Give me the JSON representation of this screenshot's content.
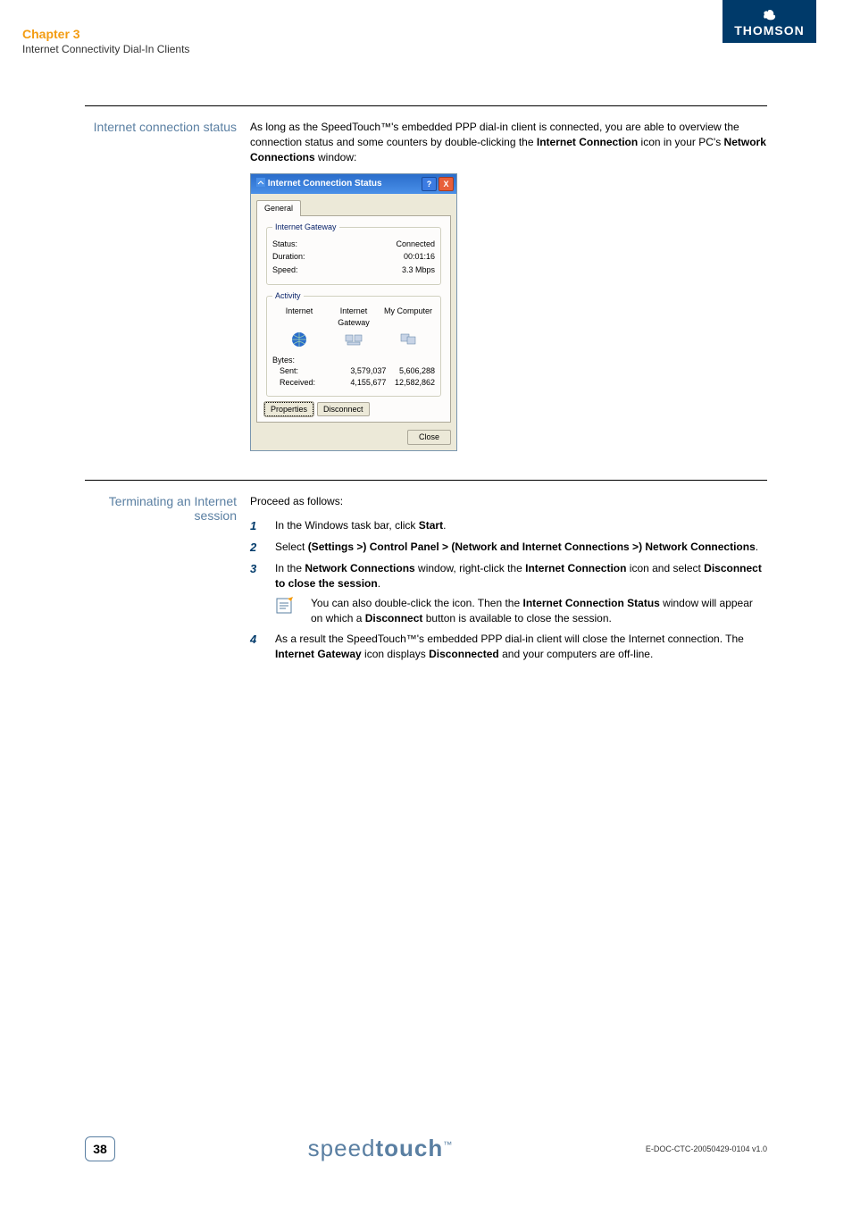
{
  "header": {
    "chapter": "Chapter 3",
    "subtitle": "Internet Connectivity Dial-In Clients",
    "brand": "THOMSON"
  },
  "section1": {
    "label": "Internet connection status",
    "para_pre": "As long as the SpeedTouch™'s embedded PPP dial-in client is connected, you are able to overview the connection status and some counters by double-clicking the ",
    "bold1": "Internet Connection",
    "para_mid1": " icon in your PC's ",
    "bold2": "Network Connections",
    "para_post": " window:"
  },
  "dialog": {
    "title": "Internet Connection Status",
    "tab": "General",
    "group1": {
      "legend": "Internet Gateway",
      "status_label": "Status:",
      "status_value": "Connected",
      "duration_label": "Duration:",
      "duration_value": "00:01:16",
      "speed_label": "Speed:",
      "speed_value": "3.3 Mbps"
    },
    "group2": {
      "legend": "Activity",
      "col1": "Internet",
      "col2": "Internet Gateway",
      "col3": "My Computer",
      "bytes_label": "Bytes:",
      "sent_label": "Sent:",
      "sent_v1": "3,579,037",
      "sent_v2": "5,606,288",
      "recv_label": "Received:",
      "recv_v1": "4,155,677",
      "recv_v2": "12,582,862"
    },
    "btn_properties": "Properties",
    "btn_disconnect": "Disconnect",
    "btn_close": "Close"
  },
  "section2": {
    "label": "Terminating an Internet session",
    "intro": "Proceed as follows:",
    "step1_pre": "In the Windows task bar, click ",
    "step1_b1": "Start",
    "step1_post": ".",
    "step2_pre": "Select ",
    "step2_b1": "(Settings >) Control Panel > (Network and Internet Connections >) Network Connections",
    "step2_post": ".",
    "step3_pre": "In the ",
    "step3_b1": "Network Connections",
    "step3_mid1": " window, right-click the ",
    "step3_b2": "Internet Connection",
    "step3_mid2": " icon and select ",
    "step3_b3": "Disconnect to close the session",
    "step3_post": ".",
    "note_pre": "You can also double-click the icon. Then the ",
    "note_b1": "Internet Connection Status",
    "note_mid1": " window will appear on which a ",
    "note_b2": "Disconnect",
    "note_post": " button is available to close the session.",
    "step4_pre": "As a result the SpeedTouch™'s embedded PPP dial-in client will close the Internet connection. The ",
    "step4_b1": "Internet Gateway",
    "step4_mid1": " icon displays ",
    "step4_b2": "Disconnected",
    "step4_post": " and your computers are off-line."
  },
  "footer": {
    "page": "38",
    "brand_light": "speed",
    "brand_bold": "touch",
    "tm": "™",
    "docid": "E-DOC-CTC-20050429-0104 v1.0"
  }
}
